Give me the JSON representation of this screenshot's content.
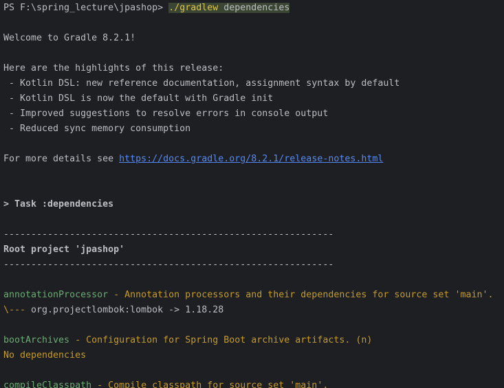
{
  "prompt": {
    "path": "PS F:\\spring_lecture\\jpashop>",
    "exe": "./gradlew",
    "args": "dependencies"
  },
  "welcome": "Welcome to Gradle 8.2.1!",
  "highlights": {
    "intro": "Here are the highlights of this release:",
    "items": [
      " - Kotlin DSL: new reference documentation, assignment syntax by default",
      " - Kotlin DSL is now the default with Gradle init",
      " - Improved suggestions to resolve errors in console output",
      " - Reduced sync memory consumption"
    ]
  },
  "details": {
    "prefix": "For more details see ",
    "url": "https://docs.gradle.org/8.2.1/release-notes.html"
  },
  "task": "> Task :dependencies",
  "separator": "------------------------------------------------------------",
  "root_project": "Root project 'jpashop'",
  "configs": [
    {
      "name": "annotationProcessor",
      "desc": " - Annotation processors and their dependencies for source set 'main'.",
      "dep_branch": "\\---",
      "dep_text": " org.projectlombok:lombok -> 1.18.28"
    },
    {
      "name": "bootArchives",
      "desc": " - Configuration for Spring Boot archive artifacts. (n)",
      "none": "No dependencies"
    },
    {
      "name": "compileClasspath",
      "desc": " - Compile classpath for source set 'main'."
    }
  ],
  "colors": {
    "background": "#1e1f22",
    "text": "#bcbec4",
    "config_name": "#6aab73",
    "config_desc": "#c79a2b",
    "link": "#548af7",
    "exe": "#e2c541",
    "command_highlight": "#3b4533"
  }
}
